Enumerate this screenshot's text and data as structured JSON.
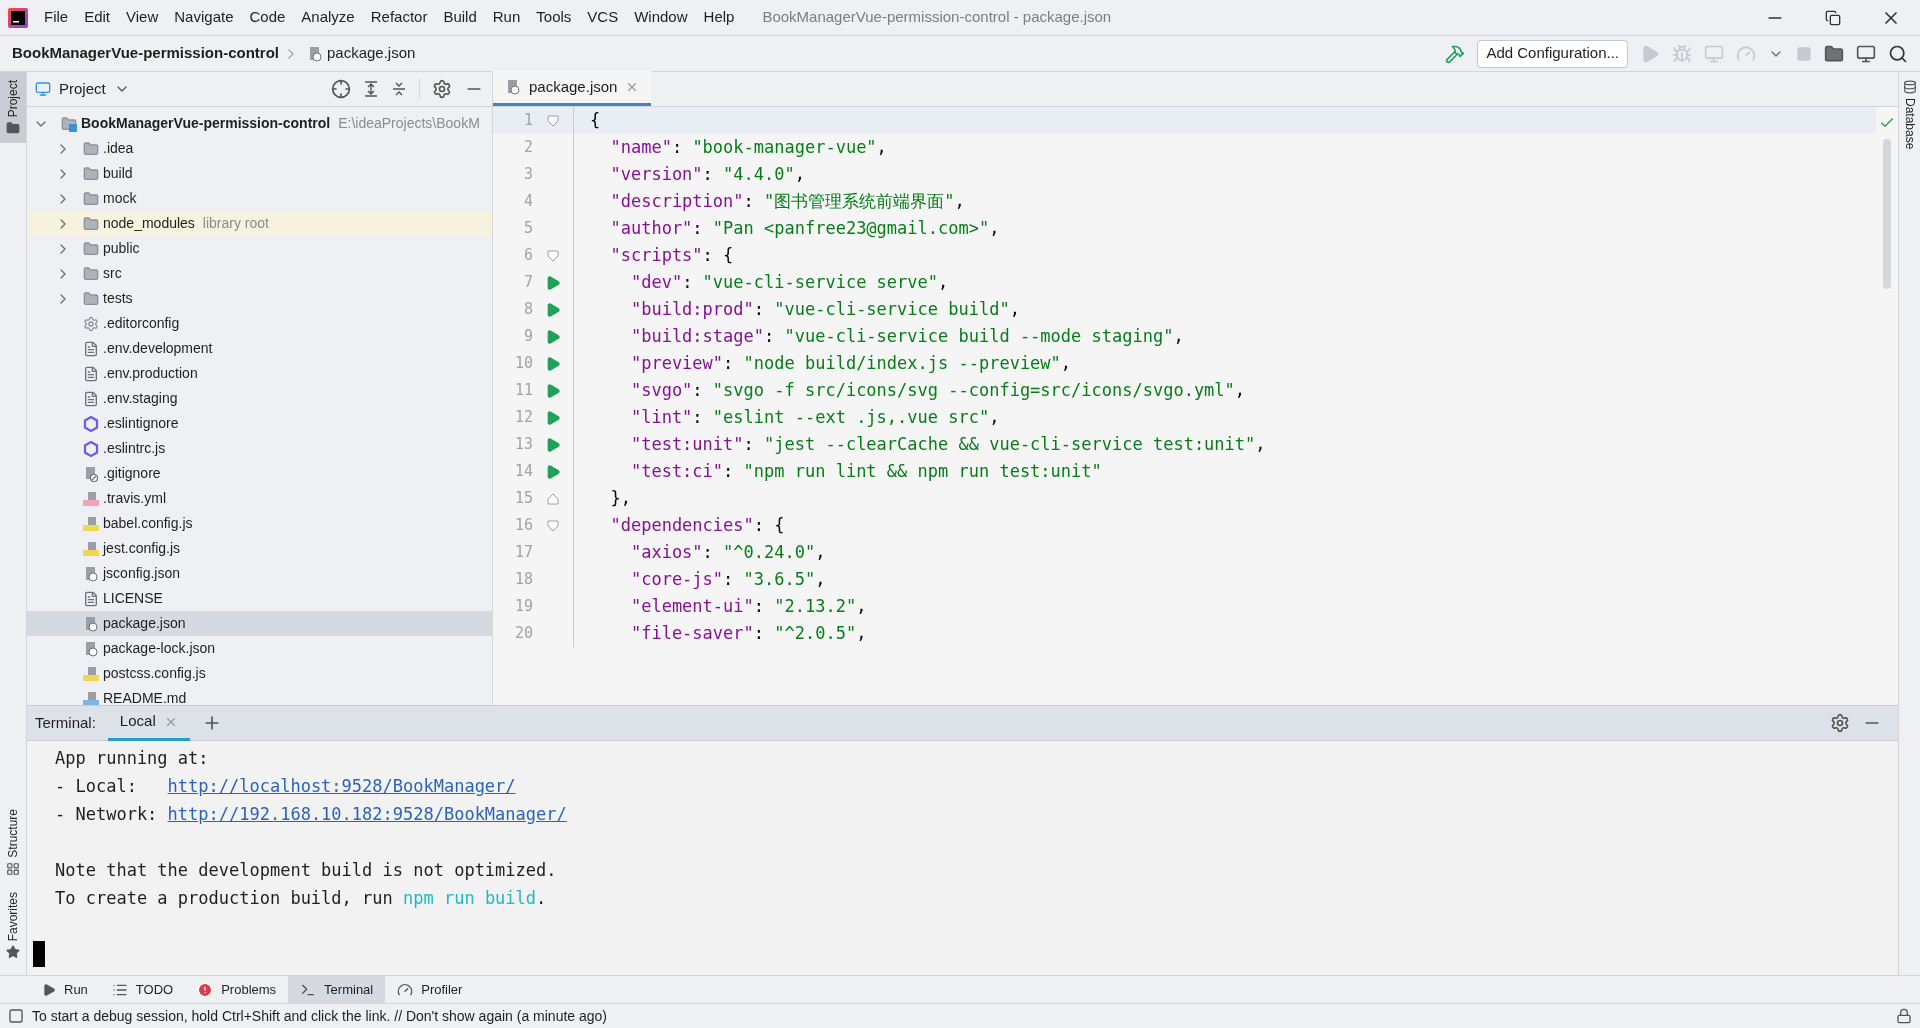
{
  "menu": [
    "File",
    "Edit",
    "View",
    "Navigate",
    "Code",
    "Analyze",
    "Refactor",
    "Build",
    "Run",
    "Tools",
    "VCS",
    "Window",
    "Help"
  ],
  "window": {
    "title": "BookManagerVue-permission-control - package.json"
  },
  "breadcrumbs": [
    {
      "label": "BookManagerVue-permission-control",
      "kind": "project"
    },
    {
      "label": "package.json",
      "kind": "json"
    }
  ],
  "toolbar": {
    "run_config": "Add Configuration..."
  },
  "left_stripe": [
    {
      "label": "Project",
      "selected": true
    },
    {
      "label": "Structure",
      "selected": false
    },
    {
      "label": "Favorites",
      "selected": false
    }
  ],
  "right_stripe": [
    {
      "label": "Database"
    }
  ],
  "project": {
    "title": "Project",
    "tree": [
      {
        "label": "BookManagerVue-permission-control",
        "kind": "module",
        "hint": "E:\\ideaProjects\\BookM",
        "expanded": true,
        "selected": false,
        "highlighted": false,
        "children": [
          {
            "label": ".idea",
            "kind": "folder",
            "expanded": false,
            "selected": false,
            "highlighted": false
          },
          {
            "label": "build",
            "kind": "folder",
            "expanded": false,
            "selected": false,
            "highlighted": false
          },
          {
            "label": "mock",
            "kind": "folder",
            "expanded": false,
            "selected": false,
            "highlighted": false
          },
          {
            "label": "node_modules",
            "kind": "folder",
            "hint": "library root",
            "expanded": false,
            "selected": false,
            "highlighted": true
          },
          {
            "label": "public",
            "kind": "folder",
            "expanded": false,
            "selected": false,
            "highlighted": false
          },
          {
            "label": "src",
            "kind": "folder",
            "expanded": false,
            "selected": false,
            "highlighted": false
          },
          {
            "label": "tests",
            "kind": "folder",
            "expanded": false,
            "selected": false,
            "highlighted": false
          },
          {
            "label": ".editorconfig",
            "kind": "config",
            "selected": false,
            "highlighted": false
          },
          {
            "label": ".env.development",
            "kind": "text",
            "selected": false,
            "highlighted": false
          },
          {
            "label": ".env.production",
            "kind": "text",
            "selected": false,
            "highlighted": false
          },
          {
            "label": ".env.staging",
            "kind": "text",
            "selected": false,
            "highlighted": false
          },
          {
            "label": ".eslintignore",
            "kind": "eslint",
            "selected": false,
            "highlighted": false
          },
          {
            "label": ".eslintrc.js",
            "kind": "eslint",
            "selected": false,
            "highlighted": false
          },
          {
            "label": ".gitignore",
            "kind": "ignore",
            "selected": false,
            "highlighted": false
          },
          {
            "label": ".travis.yml",
            "kind": "yml",
            "selected": false,
            "highlighted": false
          },
          {
            "label": "babel.config.js",
            "kind": "js",
            "selected": false,
            "highlighted": false
          },
          {
            "label": "jest.config.js",
            "kind": "js",
            "selected": false,
            "highlighted": false
          },
          {
            "label": "jsconfig.json",
            "kind": "json",
            "selected": false,
            "highlighted": false
          },
          {
            "label": "LICENSE",
            "kind": "text",
            "selected": false,
            "highlighted": false
          },
          {
            "label": "package.json",
            "kind": "json",
            "selected": true,
            "highlighted": false
          },
          {
            "label": "package-lock.json",
            "kind": "json",
            "selected": false,
            "highlighted": false
          },
          {
            "label": "postcss.config.js",
            "kind": "js",
            "selected": false,
            "highlighted": false
          },
          {
            "label": "README.md",
            "kind": "md",
            "selected": false,
            "highlighted": false
          }
        ]
      }
    ]
  },
  "editor": {
    "tabs": [
      {
        "label": "package.json",
        "selected": true
      }
    ],
    "lines": [
      {
        "number": "1",
        "kind": "fold",
        "current": true,
        "tokens": [
          {
            "kind": "punct",
            "text": "{"
          }
        ]
      },
      {
        "number": "2",
        "kind": "plain",
        "current": false,
        "tokens": [
          {
            "kind": "key",
            "text": "  \"name\""
          },
          {
            "kind": "punct",
            "text": ": "
          },
          {
            "kind": "string",
            "text": "\"book-manager-vue\""
          },
          {
            "kind": "punct",
            "text": ","
          }
        ]
      },
      {
        "number": "3",
        "kind": "plain",
        "current": false,
        "tokens": [
          {
            "kind": "key",
            "text": "  \"version\""
          },
          {
            "kind": "punct",
            "text": ": "
          },
          {
            "kind": "string",
            "text": "\"4.4.0\""
          },
          {
            "kind": "punct",
            "text": ","
          }
        ]
      },
      {
        "number": "4",
        "kind": "plain",
        "current": false,
        "tokens": [
          {
            "kind": "key",
            "text": "  \"description\""
          },
          {
            "kind": "punct",
            "text": ": "
          },
          {
            "kind": "string",
            "text": "\"图书管理系统前端界面\""
          },
          {
            "kind": "punct",
            "text": ","
          }
        ]
      },
      {
        "number": "5",
        "kind": "plain",
        "current": false,
        "tokens": [
          {
            "kind": "key",
            "text": "  \"author\""
          },
          {
            "kind": "punct",
            "text": ": "
          },
          {
            "kind": "string",
            "text": "\"Pan <panfree23@gmail.com>\""
          },
          {
            "kind": "punct",
            "text": ","
          }
        ]
      },
      {
        "number": "6",
        "kind": "fold",
        "current": false,
        "tokens": [
          {
            "kind": "key",
            "text": "  \"scripts\""
          },
          {
            "kind": "punct",
            "text": ": {"
          }
        ]
      },
      {
        "number": "7",
        "kind": "run",
        "current": false,
        "tokens": [
          {
            "kind": "key",
            "text": "    \"dev\""
          },
          {
            "kind": "punct",
            "text": ": "
          },
          {
            "kind": "string",
            "text": "\"vue-cli-service serve\""
          },
          {
            "kind": "punct",
            "text": ","
          }
        ]
      },
      {
        "number": "8",
        "kind": "run",
        "current": false,
        "tokens": [
          {
            "kind": "key",
            "text": "    \"build:prod\""
          },
          {
            "kind": "punct",
            "text": ": "
          },
          {
            "kind": "string",
            "text": "\"vue-cli-service build\""
          },
          {
            "kind": "punct",
            "text": ","
          }
        ]
      },
      {
        "number": "9",
        "kind": "run",
        "current": false,
        "tokens": [
          {
            "kind": "key",
            "text": "    \"build:stage\""
          },
          {
            "kind": "punct",
            "text": ": "
          },
          {
            "kind": "string",
            "text": "\"vue-cli-service build --mode staging\""
          },
          {
            "kind": "punct",
            "text": ","
          }
        ]
      },
      {
        "number": "10",
        "kind": "run",
        "current": false,
        "tokens": [
          {
            "kind": "key",
            "text": "    \"preview\""
          },
          {
            "kind": "punct",
            "text": ": "
          },
          {
            "kind": "string",
            "text": "\"node build/index.js --preview\""
          },
          {
            "kind": "punct",
            "text": ","
          }
        ]
      },
      {
        "number": "11",
        "kind": "run",
        "current": false,
        "tokens": [
          {
            "kind": "key",
            "text": "    \"svgo\""
          },
          {
            "kind": "punct",
            "text": ": "
          },
          {
            "kind": "string",
            "text": "\"svgo -f src/icons/svg --config=src/icons/svgo.yml\""
          },
          {
            "kind": "punct",
            "text": ","
          }
        ]
      },
      {
        "number": "12",
        "kind": "run",
        "current": false,
        "tokens": [
          {
            "kind": "key",
            "text": "    \"lint\""
          },
          {
            "kind": "punct",
            "text": ": "
          },
          {
            "kind": "string",
            "text": "\"eslint --ext .js,.vue src\""
          },
          {
            "kind": "punct",
            "text": ","
          }
        ]
      },
      {
        "number": "13",
        "kind": "run",
        "current": false,
        "tokens": [
          {
            "kind": "key",
            "text": "    \"test:unit\""
          },
          {
            "kind": "punct",
            "text": ": "
          },
          {
            "kind": "string",
            "text": "\"jest --clearCache && vue-cli-service test:unit\""
          },
          {
            "kind": "punct",
            "text": ","
          }
        ]
      },
      {
        "number": "14",
        "kind": "run",
        "current": false,
        "tokens": [
          {
            "kind": "key",
            "text": "    \"test:ci\""
          },
          {
            "kind": "punct",
            "text": ": "
          },
          {
            "kind": "string",
            "text": "\"npm run lint && npm run test:unit\""
          }
        ]
      },
      {
        "number": "15",
        "kind": "fold_end",
        "current": false,
        "tokens": [
          {
            "kind": "punct",
            "text": "  },"
          }
        ]
      },
      {
        "number": "16",
        "kind": "fold",
        "current": false,
        "tokens": [
          {
            "kind": "key",
            "text": "  \"dependencies\""
          },
          {
            "kind": "punct",
            "text": ": {"
          }
        ]
      },
      {
        "number": "17",
        "kind": "plain",
        "current": false,
        "tokens": [
          {
            "kind": "key",
            "text": "    \"axios\""
          },
          {
            "kind": "punct",
            "text": ": "
          },
          {
            "kind": "string",
            "text": "\"^0.24.0\""
          },
          {
            "kind": "punct",
            "text": ","
          }
        ]
      },
      {
        "number": "18",
        "kind": "plain",
        "current": false,
        "tokens": [
          {
            "kind": "key",
            "text": "    \"core-js\""
          },
          {
            "kind": "punct",
            "text": ": "
          },
          {
            "kind": "string",
            "text": "\"3.6.5\""
          },
          {
            "kind": "punct",
            "text": ","
          }
        ]
      },
      {
        "number": "19",
        "kind": "plain",
        "current": false,
        "tokens": [
          {
            "kind": "key",
            "text": "    \"element-ui\""
          },
          {
            "kind": "punct",
            "text": ": "
          },
          {
            "kind": "string",
            "text": "\"2.13.2\""
          },
          {
            "kind": "punct",
            "text": ","
          }
        ]
      },
      {
        "number": "20",
        "kind": "plain",
        "current": false,
        "tokens": [
          {
            "kind": "key",
            "text": "    \"file-saver\""
          },
          {
            "kind": "punct",
            "text": ": "
          },
          {
            "kind": "string",
            "text": "\"^2.0.5\""
          },
          {
            "kind": "punct",
            "text": ","
          }
        ]
      }
    ]
  },
  "terminal": {
    "title": "Terminal:",
    "tabs": [
      {
        "label": "Local",
        "selected": true
      }
    ],
    "blocks": [
      [
        [
          {
            "kind": "text",
            "text": "App running at:"
          }
        ],
        [
          {
            "kind": "text",
            "text": "- Local:   "
          },
          {
            "kind": "link",
            "text": "http://localhost:9528/BookManager/"
          }
        ],
        [
          {
            "kind": "text",
            "text": "- Network: "
          },
          {
            "kind": "link",
            "text": "http://192.168.10.182:9528/BookManager/"
          }
        ]
      ],
      [
        [
          {
            "kind": "text",
            "text": "Note that the development build is not optimized."
          }
        ],
        [
          {
            "kind": "text",
            "text": "To create a production build, run "
          },
          {
            "kind": "command",
            "text": "npm run build"
          },
          {
            "kind": "text",
            "text": "."
          }
        ]
      ]
    ]
  },
  "tool_tabs": [
    {
      "label": "Run",
      "kind": "run",
      "selected": false
    },
    {
      "label": "TODO",
      "kind": "todo",
      "selected": false
    },
    {
      "label": "Problems",
      "kind": "problems",
      "selected": false
    },
    {
      "label": "Terminal",
      "kind": "terminal",
      "selected": true
    },
    {
      "label": "Profiler",
      "kind": "profiler",
      "selected": false
    }
  ],
  "status_bar": {
    "message": "To start a debug session, hold Ctrl+Shift and click the link. // Don't show again (a minute ago)"
  }
}
